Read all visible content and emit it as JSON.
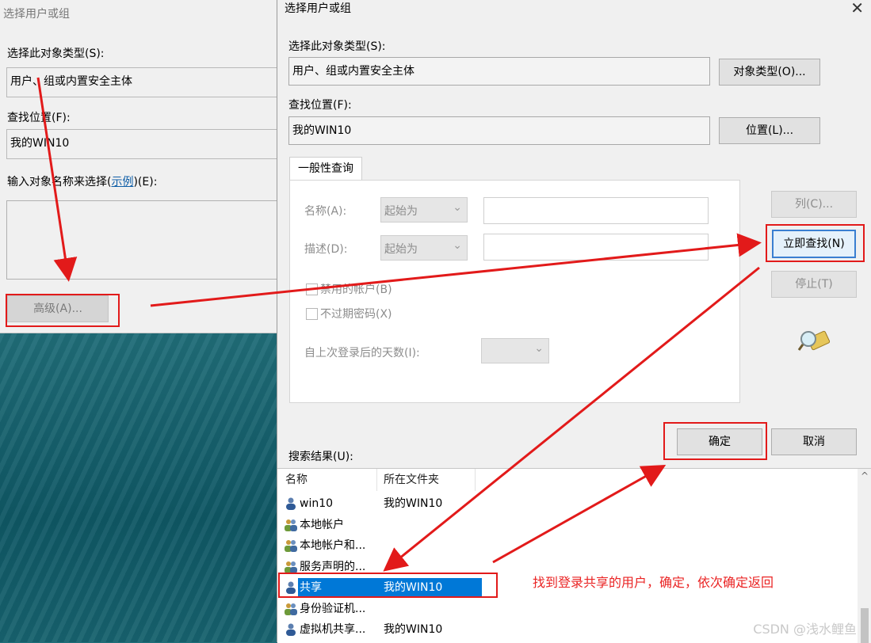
{
  "back_dialog": {
    "title": "选择用户或组",
    "object_type_label": "选择此对象类型(S):",
    "object_type_value": "用户、组或内置安全主体",
    "location_label": "查找位置(F):",
    "location_value": "我的WIN10",
    "enter_names_prefix": "输入对象名称来选择(",
    "enter_names_link": "示例",
    "enter_names_suffix": ")(E):",
    "advanced_button": "高级(A)..."
  },
  "front_dialog": {
    "title": "选择用户或组",
    "close_glyph": "✕",
    "object_type_label": "选择此对象类型(S):",
    "object_type_value": "用户、组或内置安全主体",
    "object_types_button": "对象类型(O)...",
    "location_label": "查找位置(F):",
    "location_value": "我的WIN10",
    "locations_button": "位置(L)...",
    "tab_label": "一般性查询",
    "query": {
      "name_label": "名称(A):",
      "name_op": "起始为",
      "desc_label": "描述(D):",
      "desc_op": "起始为",
      "disabled_accounts": "禁用的帐户(B)",
      "non_expiring_pwd": "不过期密码(X)",
      "days_since_login": "自上次登录后的天数(I):"
    },
    "columns_button": "列(C)...",
    "find_now_button": "立即查找(N)",
    "stop_button": "停止(T)",
    "ok_button": "确定",
    "cancel_button": "取消",
    "results_label": "搜索结果(U):",
    "results": {
      "headers": [
        "名称",
        "所在文件夹"
      ],
      "rows": [
        {
          "name": "win10",
          "folder": "我的WIN10",
          "icon": "user-icon"
        },
        {
          "name": "本地帐户",
          "folder": "",
          "icon": "group-icon"
        },
        {
          "name": "本地帐户和...",
          "folder": "",
          "icon": "group-icon"
        },
        {
          "name": "服务声明的...",
          "folder": "",
          "icon": "group-icon"
        },
        {
          "name": "共享",
          "folder": "我的WIN10",
          "icon": "user-icon",
          "selected": true
        },
        {
          "name": "身份验证机...",
          "folder": "",
          "icon": "group-icon"
        },
        {
          "name": "虚拟机共享...",
          "folder": "我的WIN10",
          "icon": "user-icon"
        }
      ]
    }
  },
  "annotation": "找到登录共享的用户，确定，依次确定返回",
  "watermark": "CSDN @浅水鲤鱼",
  "colors": {
    "annotation_red": "#e21a1a",
    "selection_blue": "#0078d7"
  }
}
